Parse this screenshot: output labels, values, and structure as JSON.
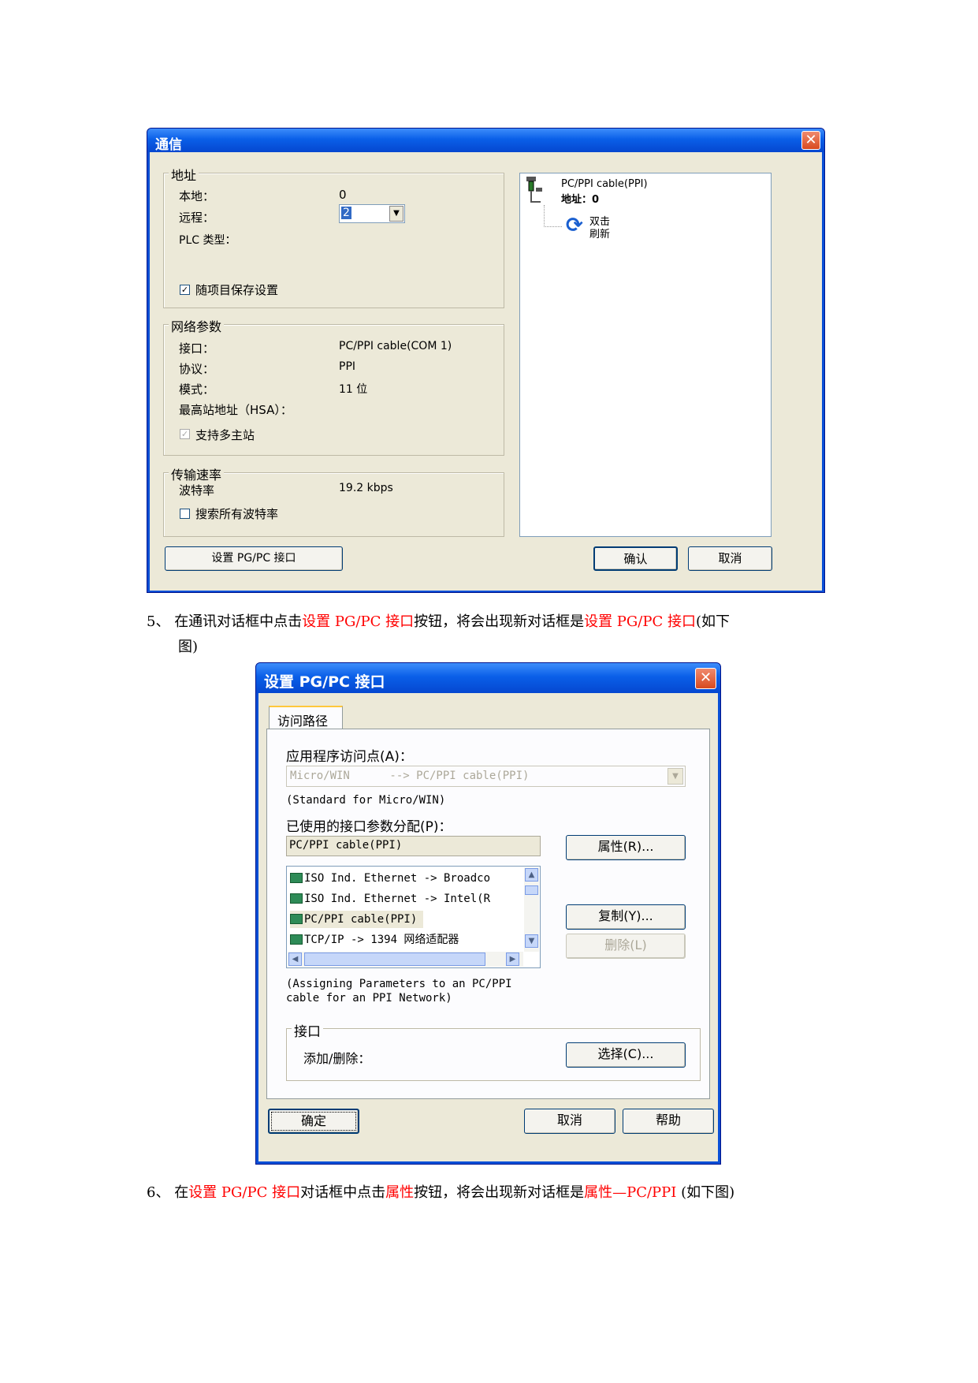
{
  "comm_dialog": {
    "title": "通信",
    "address_group": "地址",
    "local_label": "本地：",
    "local_value": "0",
    "remote_label": "远程：",
    "remote_value": "2",
    "plc_type_label": "PLC 类型：",
    "save_settings_label": "随项目保存设置",
    "network_group": "网络参数",
    "interface_label": "接口：",
    "interface_value": "PC/PPI cable(COM 1)",
    "protocol_label": "协议：",
    "protocol_value": "PPI",
    "mode_label": "模式：",
    "mode_value": "11 位",
    "hsa_label": "最高站地址（HSA）：",
    "multimaster_label": "支持多主站",
    "rate_group": "传输速率",
    "baud_label": "波特率",
    "baud_value": "19.2 kbps",
    "search_baud_label": "搜索所有波特率",
    "tree_cable": "PC/PPI cable(PPI)",
    "tree_address": "地址：0",
    "tree_refresh_line1": "双击",
    "tree_refresh_line2": "刷新",
    "set_pgpc_button": "设置 PG/PC 接口",
    "ok_button": "确认",
    "cancel_button": "取消"
  },
  "step5": {
    "number": "5、",
    "t1": "在通讯对话框中点击",
    "t2": "设置 PG/PC 接口",
    "t3": "按钮，将会出现新对话框是",
    "t4": "设置 PG/PC 接口",
    "t5": "(如下",
    "t6": "图)"
  },
  "pgpc_dialog": {
    "title": "设置 PG/PC 接口",
    "tab_label": "访问路径",
    "access_point_label": "应用程序访问点(A)：",
    "access_point_value": "Micro/WIN      --> PC/PPI cable(PPI)",
    "access_point_desc": "(Standard for Micro/WIN)",
    "used_params_label": "已使用的接口参数分配(P)：",
    "used_params_value": "PC/PPI cable(PPI)",
    "list_items": [
      "ISO Ind. Ethernet -> Broadco",
      "ISO Ind. Ethernet -> Intel(R",
      "PC/PPI cable(PPI)",
      "TCP/IP -> 1394 网络适配器"
    ],
    "properties_button": "属性(R)...",
    "copy_button": "复制(Y)...",
    "delete_button": "删除(L)",
    "assign_desc_line1": "(Assigning Parameters to an PC/PPI",
    "assign_desc_line2": "cable for an PPI Network)",
    "interface_group": "接口",
    "add_remove_label": "添加/删除：",
    "select_button": "选择(C)...",
    "ok_button": "确定",
    "cancel_button": "取消",
    "help_button": "帮助"
  },
  "step6": {
    "number": "6、",
    "t1": "在",
    "t2": "设置 PG/PC 接口",
    "t3": "对话框中点击",
    "t4": "属性",
    "t5": "按钮，将会出现新对话框是",
    "t6": "属性—PC/PPI",
    "t7": "(如下图)"
  },
  "colors": {
    "highlight_red": "#ff0000",
    "xp_title_blue": "#0a5fe8",
    "dialog_face": "#ece9d8"
  }
}
